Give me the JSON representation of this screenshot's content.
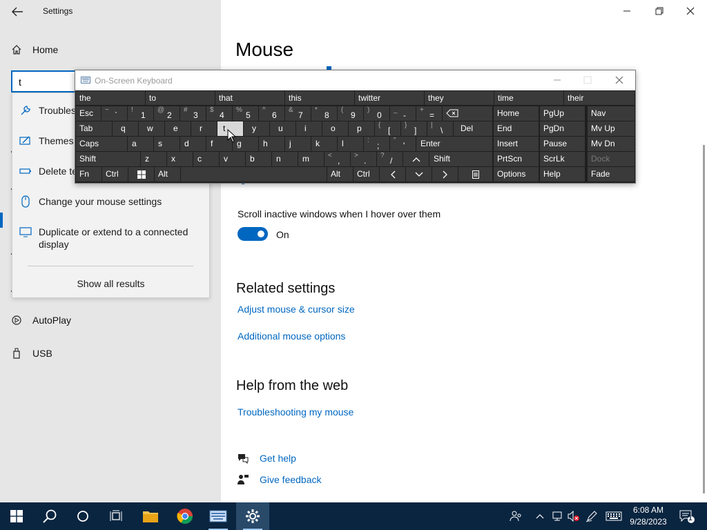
{
  "window": {
    "title": "Settings"
  },
  "left_nav": {
    "home": "Home",
    "autoplay": "AutoPlay",
    "usb": "USB"
  },
  "search": {
    "value": "t",
    "results": [
      {
        "label": "Troubles",
        "icon": "wrench-icon"
      },
      {
        "label": "Themes",
        "icon": "paintbrush-icon"
      },
      {
        "label": "Delete te",
        "icon": "battery-icon"
      },
      {
        "label": "Change your mouse settings",
        "icon": "mouse-icon"
      },
      {
        "label": "Duplicate or extend to a connected display",
        "icon": "monitor-icon"
      }
    ],
    "show_all": "Show all results"
  },
  "main": {
    "title": "Mouse",
    "scroll_inactive_label": "Scroll inactive windows when I hover over them",
    "scroll_inactive_state": "On",
    "related_heading": "Related settings",
    "links": {
      "adjust": "Adjust mouse & cursor size",
      "additional": "Additional mouse options"
    },
    "help_heading": "Help from the web",
    "help_link": "Troubleshooting my mouse",
    "get_help": "Get help",
    "give_feedback": "Give feedback"
  },
  "osk": {
    "title": "On-Screen Keyboard",
    "predictions": [
      "the",
      "to",
      "that",
      "this",
      "twitter",
      "they",
      "time",
      "their"
    ],
    "row1": [
      {
        "shift": "",
        "main": "Esc"
      },
      {
        "shift": "~",
        "main": "`"
      },
      {
        "shift": "!",
        "main": "1"
      },
      {
        "shift": "@",
        "main": "2"
      },
      {
        "shift": "#",
        "main": "3"
      },
      {
        "shift": "$",
        "main": "4"
      },
      {
        "shift": "%",
        "main": "5"
      },
      {
        "shift": "^",
        "main": "6"
      },
      {
        "shift": "&",
        "main": "7"
      },
      {
        "shift": "*",
        "main": "8"
      },
      {
        "shift": "(",
        "main": "9"
      },
      {
        "shift": ")",
        "main": "0"
      },
      {
        "shift": "_",
        "main": "-"
      },
      {
        "shift": "+",
        "main": "="
      }
    ],
    "row2": [
      "Tab",
      "q",
      "w",
      "e",
      "r",
      "t",
      "y",
      "u",
      "i",
      "o",
      "p"
    ],
    "row2_brackets": [
      {
        "shift": "{",
        "main": "["
      },
      {
        "shift": "}",
        "main": "]"
      },
      {
        "shift": "|",
        "main": "\\"
      }
    ],
    "row2_del": "Del",
    "row3": [
      "Caps",
      "a",
      "s",
      "d",
      "f",
      "g",
      "h",
      "j",
      "k",
      "l"
    ],
    "row3_punct": [
      {
        "shift": ":",
        "main": ";"
      },
      {
        "shift": "\"",
        "main": "'"
      }
    ],
    "row3_enter": "Enter",
    "row4": [
      "Shift",
      "z",
      "x",
      "c",
      "v",
      "b",
      "n",
      "m"
    ],
    "row4_punct": [
      {
        "shift": "<",
        "main": ","
      },
      {
        "shift": ">",
        "main": "."
      },
      {
        "shift": "?",
        "main": "/"
      }
    ],
    "row4_shift_right": "Shift",
    "row5": {
      "fn": "Fn",
      "ctrl": "Ctrl",
      "alt": "Alt",
      "alt_r": "Alt",
      "ctrl_r": "Ctrl"
    },
    "nav_keys": [
      [
        "Home",
        "PgUp",
        "Nav"
      ],
      [
        "End",
        "PgDn",
        "Mv Up"
      ],
      [
        "Insert",
        "Pause",
        "Mv Dn"
      ],
      [
        "PrtScn",
        "ScrLk",
        "Dock"
      ],
      [
        "Options",
        "Help",
        "Fade"
      ]
    ]
  },
  "taskbar": {
    "time": "6:08 AM",
    "date": "9/28/2023",
    "notification_count": "1"
  }
}
